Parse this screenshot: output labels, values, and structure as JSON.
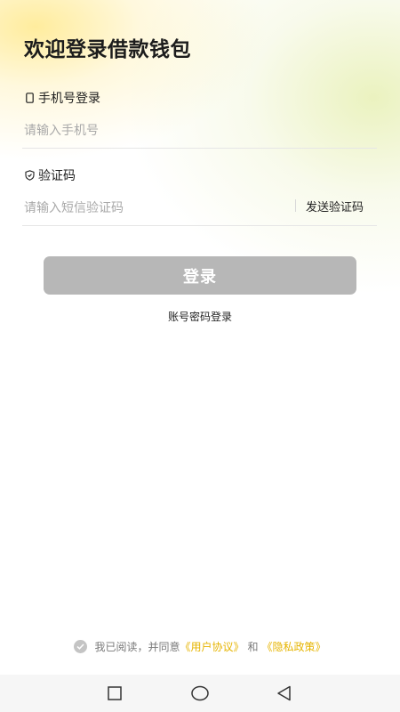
{
  "header": {
    "title": "欢迎登录借款钱包"
  },
  "phone": {
    "label": "手机号登录",
    "label_icon": "phone-icon",
    "placeholder": "请输入手机号",
    "value": ""
  },
  "code": {
    "label": "验证码",
    "label_icon": "shield-icon",
    "placeholder": "请输入短信验证码",
    "value": "",
    "send_label": "发送验证码"
  },
  "login": {
    "button_label": "登录",
    "button_color": "#b7b7b7",
    "alt_login_label": "账号密码登录"
  },
  "agreement": {
    "prefix": "我已阅读，并同意",
    "user_agreement": "《用户协议》",
    "conjunction": "和",
    "privacy_policy": "《隐私政策》",
    "checked": false,
    "link_color": "#e6b400"
  },
  "system_nav": {
    "icons": [
      "recent-apps-icon",
      "home-icon",
      "back-icon"
    ]
  }
}
